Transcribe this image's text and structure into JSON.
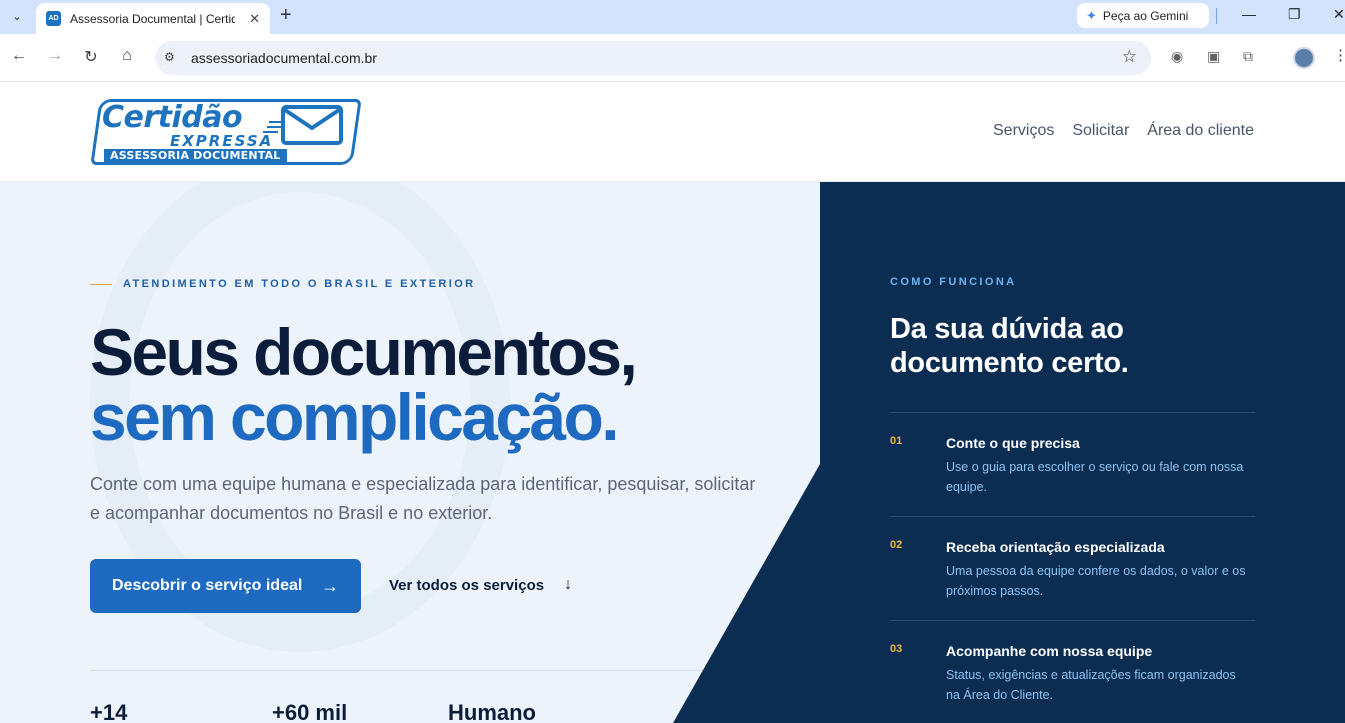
{
  "browser": {
    "tab_title": "Assessoria Documental | Certid",
    "tab_favicon": "AD",
    "gemini_label": "Peça ao Gemini",
    "url": "assessoriadocumental.com.br"
  },
  "logo": {
    "main": "Certidão",
    "express": "EXPRESSA",
    "sub": "ASSESSORIA DOCUMENTAL"
  },
  "nav": {
    "items": [
      "Serviços",
      "Solicitar",
      "Área do cliente"
    ]
  },
  "hero": {
    "eyebrow": "ATENDIMENTO EM TODO O BRASIL E EXTERIOR",
    "headline_1": "Seus documentos,",
    "headline_2": "sem complicação.",
    "text": "Conte com uma equipe humana e especializada para identificar, pesquisar, solicitar e acompanhar documentos no Brasil e no exterior.",
    "primary_button": "Descobrir o serviço ideal",
    "primary_arrow": "→",
    "secondary_button": "Ver todos os serviços",
    "secondary_arrow": "↓",
    "stats": [
      "+14",
      "+60 mil",
      "Humano"
    ]
  },
  "how": {
    "eyebrow": "COMO FUNCIONA",
    "title": "Da sua dúvida ao documento certo.",
    "steps": [
      {
        "num": "01",
        "title": "Conte o que precisa",
        "desc": "Use o guia para escolher o serviço ou fale com nossa equipe."
      },
      {
        "num": "02",
        "title": "Receba orientação especializada",
        "desc": "Uma pessoa da equipe confere os dados, o valor e os próximos passos."
      },
      {
        "num": "03",
        "title": "Acompanhe com nossa equipe",
        "desc": "Status, exigências e atualizações ficam organizados na Área do Cliente."
      }
    ]
  },
  "colors": {
    "brand_blue": "#1e6ac0",
    "navy": "#0c2d52",
    "accent_gold": "#f0b73a",
    "hero_bg": "#edf3fa"
  },
  "icons": [
    "tab-search-icon",
    "close-icon",
    "plus-icon",
    "gemini-icon",
    "minimize-icon",
    "restore-icon",
    "back-icon",
    "forward-icon",
    "reload-icon",
    "home-icon",
    "site-info-icon",
    "bookmark-star-icon",
    "extension-icon",
    "menu-icon"
  ]
}
